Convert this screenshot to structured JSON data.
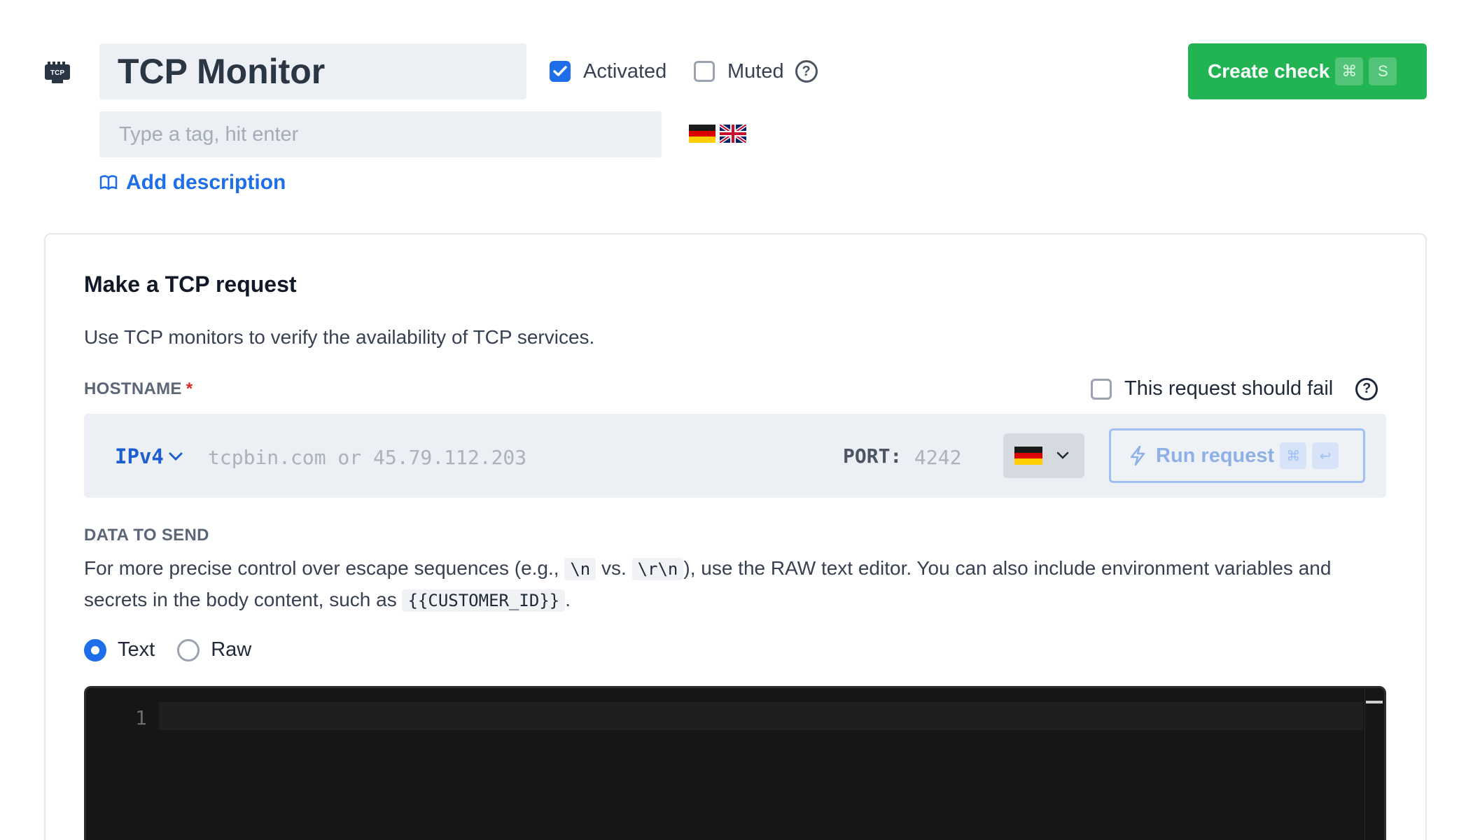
{
  "header": {
    "monitor_icon_text": "TCP",
    "monitor_name": "TCP Monitor",
    "activated_label": "Activated",
    "activated_checked": true,
    "muted_label": "Muted",
    "muted_checked": false,
    "create_button_label": "Create check",
    "create_shortcut": [
      "⌘",
      "S"
    ],
    "tag_placeholder": "Type a tag, hit enter",
    "flags": [
      "flag-germany-icon",
      "flag-uk-icon"
    ],
    "add_description_label": "Add description"
  },
  "card": {
    "title": "Make a TCP request",
    "subtitle": "Use TCP monitors to verify the availability of TCP services.",
    "hostname_label": "HOSTNAME",
    "required_marker": "*",
    "should_fail_label": "This request should fail",
    "should_fail_checked": false,
    "ip_version": "IPv4",
    "hostname_placeholder": "tcpbin.com or 45.79.112.203",
    "port_label": "PORT:",
    "port_placeholder": "4242",
    "run_location_flag": "flag-germany-icon",
    "run_button_label": "Run request",
    "run_shortcut": [
      "⌘",
      "↩"
    ],
    "data_label": "DATA TO SEND",
    "data_help": {
      "part1": "For more precise control over escape sequences (e.g., ",
      "code1": "\\n",
      "part2": " vs. ",
      "code2": "\\r\\n",
      "part3": "), use the RAW text editor. You can also include environment variables and secrets in the body content, such as ",
      "code3": "{{CUSTOMER_ID}}",
      "part4": "."
    },
    "mode_options": [
      "Text",
      "Raw"
    ],
    "mode_selected": "Text",
    "editor": {
      "line_numbers": [
        "1"
      ],
      "content": ""
    }
  },
  "colors": {
    "accent": "#1d6ee8",
    "create_button": "#22b453",
    "field_bg": "#eceff3",
    "editor_bg": "#161616"
  }
}
